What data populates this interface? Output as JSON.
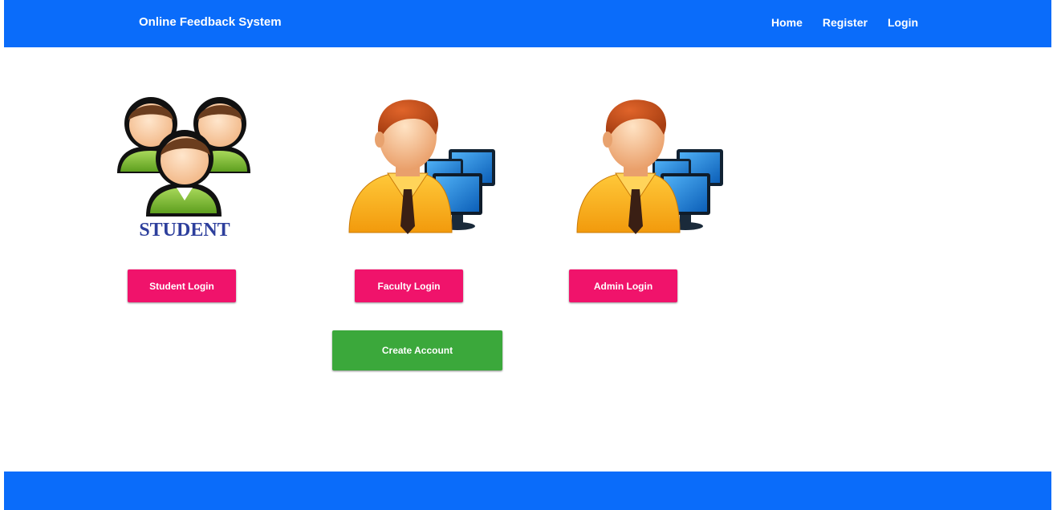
{
  "header": {
    "brand": "Online Feedback System",
    "nav": [
      "Home",
      "Register",
      "Login"
    ]
  },
  "cards": {
    "student": {
      "image_caption": "STUDENT",
      "button": "Student Login"
    },
    "faculty": {
      "button": "Faculty Login"
    },
    "admin": {
      "button": "Admin Login"
    }
  },
  "create_account": "Create Account",
  "colors": {
    "nav_blue": "#0a6cfa",
    "button_pink": "#f0136b",
    "button_green": "#3ba83b"
  }
}
